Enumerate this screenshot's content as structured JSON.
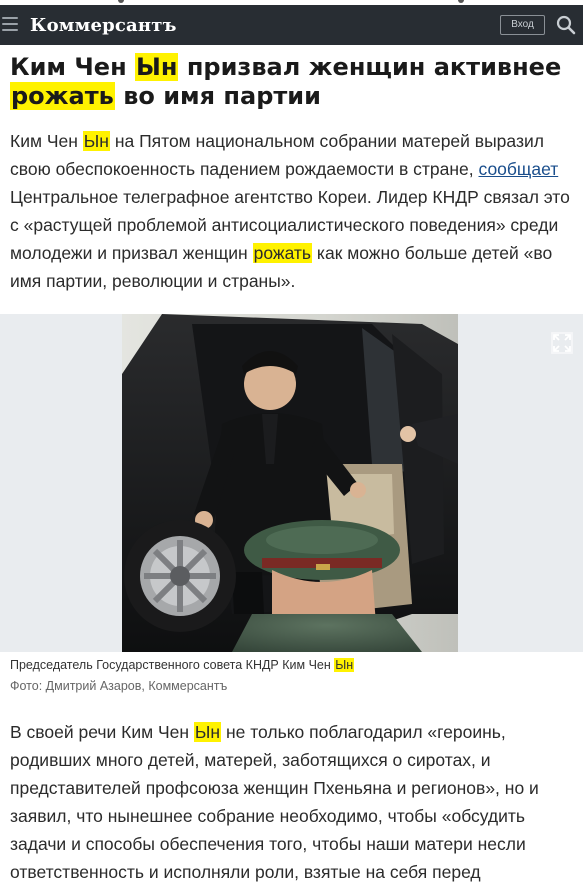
{
  "header": {
    "brand": "Коммерсантъ",
    "login_label": "Вход",
    "menu_icon": "hamburger-menu-icon",
    "search_icon": "search-icon",
    "background": "#282d33"
  },
  "article": {
    "headline": {
      "part1": "Ким Чен ",
      "hl1": "Ын",
      "part2": " призвал женщин активнее ",
      "hl2": "рожать",
      "part3": " во имя партии"
    },
    "lead": {
      "part1": "Ким Чен ",
      "hl1": "Ын",
      "part2": " на Пятом национальном собрании матерей выразил свою обеспокоенность падением рождаемости в стране, ",
      "link": "сообщает",
      "part3": " Центральное телеграфное агентство Кореи. Лидер КНДР связал это с «растущей проблемой антисоциалистического поведения» среди молодежи и призвал женщин ",
      "hl2": "рожать",
      "part4": " как можно больше детей «во имя партии, революции и страны»."
    },
    "photo": {
      "expand_icon": "fullscreen-expand-icon",
      "caption_prefix": "Председатель Государственного совета КНДР Ким Чен ",
      "caption_hl": "Ын",
      "credit": "Фото: Дмитрий Азаров, Коммерсантъ"
    },
    "body": {
      "part1": "В своей речи Ким Чен ",
      "hl1": "Ын",
      "part2": " не только поблагодарил «героинь, родивших много детей, матерей, заботящихся о сиротах, и представителей профсоюза женщин Пхеньяна и регионов», но и заявил, что нынешнее собрание необходимо, чтобы «обсудить задачи и способы обеспечения того, чтобы наши матери несли ответственность и исполняли роли, взятые на себя перед обществом"
    },
    "highlight_color": "#fff200",
    "link_color": "#1a4e8c"
  }
}
